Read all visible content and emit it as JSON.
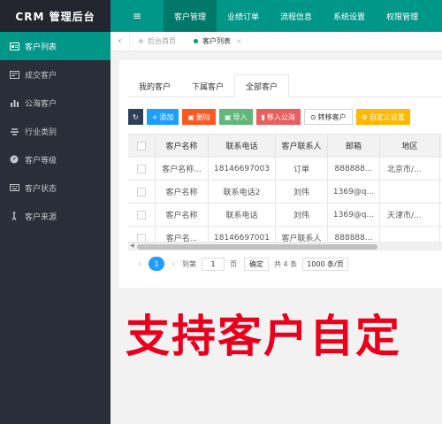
{
  "brand": "CRM  管理后台",
  "sidebar": {
    "items": [
      {
        "label": "客户列表",
        "icon": "id-card-icon"
      },
      {
        "label": "成交客户",
        "icon": "card-icon"
      },
      {
        "label": "公海客户",
        "icon": "bar-chart-icon"
      },
      {
        "label": "行业类别",
        "icon": "stack-icon"
      },
      {
        "label": "客户等级",
        "icon": "compass-icon"
      },
      {
        "label": "客户状态",
        "icon": "keyboard-icon"
      },
      {
        "label": "客户来源",
        "icon": "person-walk-icon"
      }
    ]
  },
  "header": {
    "menu_icon": "≡",
    "nav": [
      {
        "label": "客户管理"
      },
      {
        "label": "业绩订单"
      },
      {
        "label": "流程信息"
      },
      {
        "label": "系统设置"
      },
      {
        "label": "权限管理"
      }
    ]
  },
  "tabbar": {
    "back": "‹",
    "tabs": [
      {
        "label": "后台首页"
      },
      {
        "label": "客户列表",
        "close": "×"
      }
    ]
  },
  "subtabs": [
    {
      "label": "我的客户"
    },
    {
      "label": "下属客户"
    },
    {
      "label": "全部客户"
    }
  ],
  "toolbar": [
    {
      "label": "",
      "icon": "↻",
      "color": "#2f4056"
    },
    {
      "label": "添加",
      "icon": "+",
      "color": "#1e9fff"
    },
    {
      "label": "删除",
      "icon": "▣",
      "color": "#ff5722"
    },
    {
      "label": "导入",
      "icon": "▣",
      "color": "#5fb878"
    },
    {
      "label": "移入公海",
      "icon": "▮",
      "color": "#e95e5e"
    },
    {
      "label": "转移客户",
      "icon": "⊙",
      "color": "#ffffff"
    },
    {
      "label": "自定义设置",
      "icon": "⚙",
      "color": "#ffb800"
    }
  ],
  "table": {
    "headers": [
      "客户名称",
      "联系电话",
      "客户联系人",
      "邮箱",
      "地区"
    ],
    "rows": [
      [
        "客户名称...",
        "18146697003",
        "订单",
        "888888...",
        "北京市/..."
      ],
      [
        "客户名称",
        "联系电话2",
        "刘伟",
        "1369@q...",
        ""
      ],
      [
        "客户名称",
        "联系电话",
        "刘伟",
        "1369@q...",
        "天津市/..."
      ],
      [
        "客户名...",
        "18146697001",
        "客户联系人",
        "888888...",
        ""
      ]
    ]
  },
  "pager": {
    "prev": "‹",
    "current": "1",
    "next": "›",
    "goto_label": "到第",
    "goto_value": "1",
    "page_label": "页",
    "confirm": "确定",
    "total": "共 4 条",
    "page_size": "1000 条/页"
  },
  "banner": "支持客户自定"
}
